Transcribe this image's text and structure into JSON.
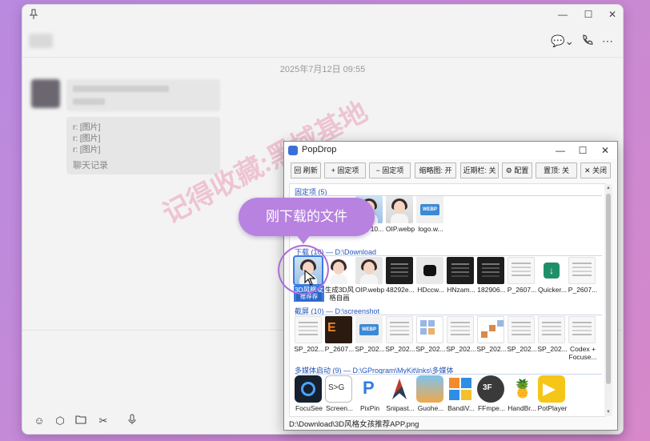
{
  "chat": {
    "timestamp": "2025年7月12日 09:55",
    "forward_lines": [
      "r: [图片]",
      "r: [图片]",
      "r: [图片]"
    ],
    "forward_footer": "聊天记录",
    "watermark": "记得收藏:黑域基地",
    "header_icons": [
      "chat-menu-icon",
      "call-icon",
      "more-icon"
    ],
    "toolbar_icons": [
      "emoji-icon",
      "cube-icon",
      "folder-icon",
      "scissors-icon",
      "mic-icon"
    ]
  },
  "popdrop": {
    "title": "PopDrop",
    "toolbar": [
      {
        "icon": "回",
        "label": "刷新"
      },
      {
        "icon": "+",
        "label": "固定项"
      },
      {
        "icon": "−",
        "label": "固定项"
      },
      {
        "label": "缩略图: 开"
      },
      {
        "label": "近期栏: 关"
      },
      {
        "icon": "⚙",
        "label": "配置"
      },
      {
        "label": "置顶: 关"
      },
      {
        "icon": "✕",
        "label": "关闭"
      }
    ],
    "sections": [
      {
        "header": "固定项 (5)",
        "items": [
          "...画 10...",
          "OIP.webp",
          "logo.w..."
        ]
      },
      {
        "header": "下载 (10)  —  D:\\Download",
        "items": [
          "3D风格女孩推荐APP.png",
          "生成3D风格自画像...",
          "OIP.webp",
          "48292e...",
          "HDccw...",
          "HNzam...",
          "182906...",
          "P_2607...",
          "Quicker...",
          "P_2607..."
        ],
        "selected_badge": "推荐荐"
      },
      {
        "header": "截屏 (10)  —  D:\\screenshot",
        "items": [
          "SP_202...",
          "P_2607...",
          "SP_202...",
          "SP_202...",
          "SP_202...",
          "SP_202...",
          "SP_202...",
          "SP_202...",
          "SP_202...",
          "Codex + Focuse..."
        ]
      },
      {
        "header": "多媒体启动 (9)  —  D:\\GProgram\\MyKit\\lnks\\多媒体",
        "items": [
          "FocuSee",
          "Screen...",
          "PixPin",
          "Snipast...",
          "Guohe...",
          "BandiV...",
          "FFmpe...",
          "HandBr...",
          "PotPlayer"
        ]
      }
    ],
    "status_path": "D:\\Download\\3D风格女孩推荐APP.png"
  },
  "callout": "刚下载的文件",
  "colors": {
    "accent": "#3b7be0",
    "callout": "#b782e0",
    "section_header": "#2455b8"
  }
}
